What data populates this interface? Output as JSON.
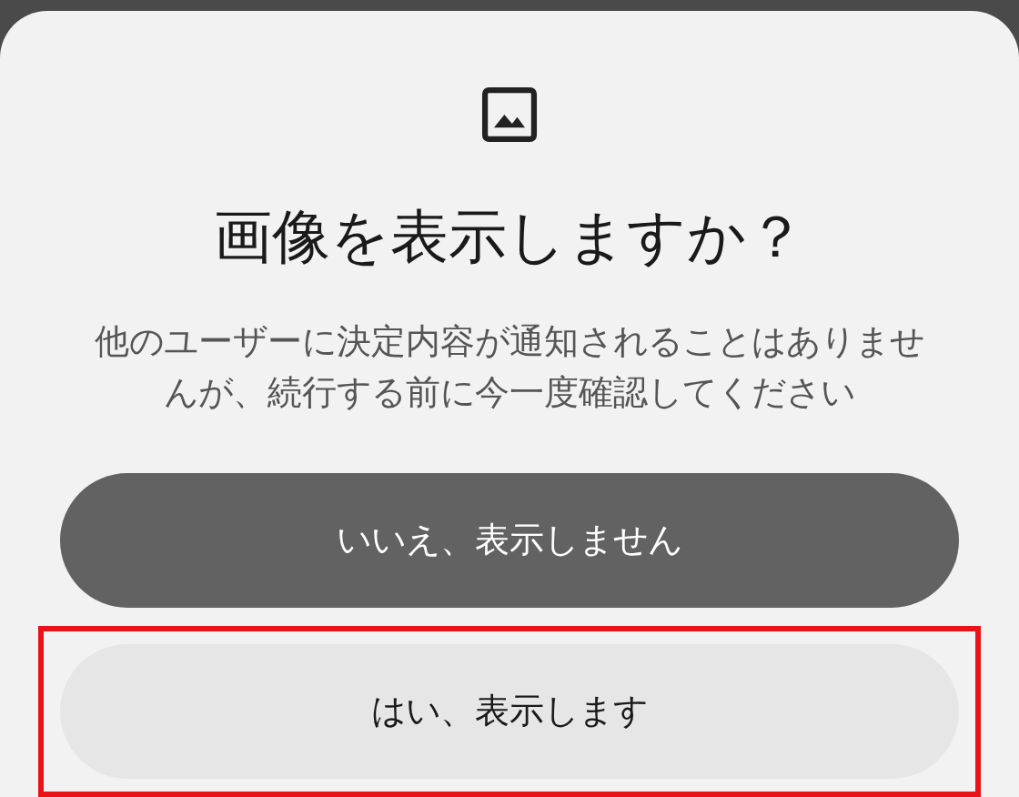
{
  "dialog": {
    "title": "画像を表示しますか？",
    "message": "他のユーザーに決定内容が通知されることはありませんが、続行する前に今一度確認してください"
  },
  "buttons": [
    {
      "label": "いいえ、表示しません",
      "kind": "primary",
      "highlighted": false
    },
    {
      "label": "はい、表示します",
      "kind": "secondary",
      "highlighted": true
    }
  ]
}
